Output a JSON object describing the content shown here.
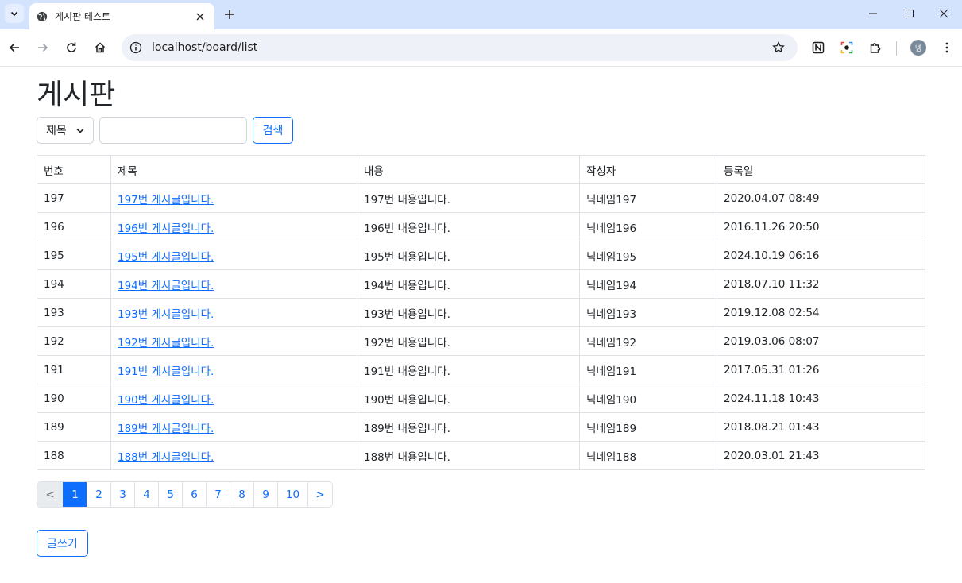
{
  "browser": {
    "tab_title": "게시판 테스트",
    "url": "localhost/board/list",
    "profile_initial": "넴"
  },
  "page": {
    "title": "게시판",
    "search": {
      "field_selected": "제목",
      "input_value": "",
      "button_label": "검색"
    },
    "table": {
      "headers": [
        "번호",
        "제목",
        "내용",
        "작성자",
        "등록일"
      ],
      "rows": [
        {
          "no": "197",
          "title": "197번 게시글입니다.",
          "content": "197번 내용입니다.",
          "author": "닉네임197",
          "date": "2020.04.07 08:49"
        },
        {
          "no": "196",
          "title": "196번 게시글입니다.",
          "content": "196번 내용입니다.",
          "author": "닉네임196",
          "date": "2016.11.26 20:50"
        },
        {
          "no": "195",
          "title": "195번 게시글입니다.",
          "content": "195번 내용입니다.",
          "author": "닉네임195",
          "date": "2024.10.19 06:16"
        },
        {
          "no": "194",
          "title": "194번 게시글입니다.",
          "content": "194번 내용입니다.",
          "author": "닉네임194",
          "date": "2018.07.10 11:32"
        },
        {
          "no": "193",
          "title": "193번 게시글입니다.",
          "content": "193번 내용입니다.",
          "author": "닉네임193",
          "date": "2019.12.08 02:54"
        },
        {
          "no": "192",
          "title": "192번 게시글입니다.",
          "content": "192번 내용입니다.",
          "author": "닉네임192",
          "date": "2019.03.06 08:07"
        },
        {
          "no": "191",
          "title": "191번 게시글입니다.",
          "content": "191번 내용입니다.",
          "author": "닉네임191",
          "date": "2017.05.31 01:26"
        },
        {
          "no": "190",
          "title": "190번 게시글입니다.",
          "content": "190번 내용입니다.",
          "author": "닉네임190",
          "date": "2024.11.18 10:43"
        },
        {
          "no": "189",
          "title": "189번 게시글입니다.",
          "content": "189번 내용입니다.",
          "author": "닉네임189",
          "date": "2018.08.21 01:43"
        },
        {
          "no": "188",
          "title": "188번 게시글입니다.",
          "content": "188번 내용입니다.",
          "author": "닉네임188",
          "date": "2020.03.01 21:43"
        }
      ]
    },
    "pagination": {
      "prev_label": "<",
      "next_label": ">",
      "pages": [
        "1",
        "2",
        "3",
        "4",
        "5",
        "6",
        "7",
        "8",
        "9",
        "10"
      ],
      "active_page": "1"
    },
    "write_button_label": "글쓰기"
  },
  "colors": {
    "accent": "#0d6efd",
    "tabstrip": "#d3e3fd",
    "border": "#dee2e6"
  }
}
